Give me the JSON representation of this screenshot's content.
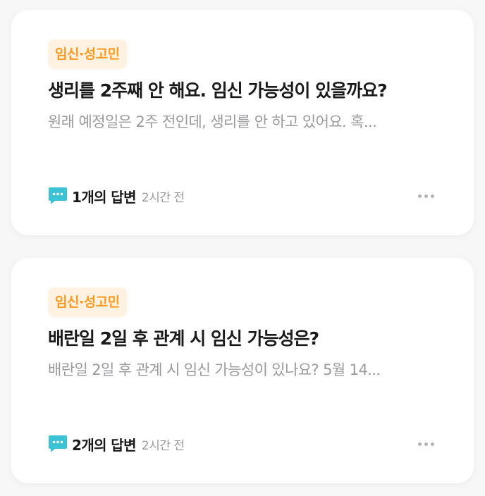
{
  "accent_tag_color": "#ff9a1f",
  "accent_tag_bg": "#fff2e2",
  "comment_icon_color": "#3cc2d6",
  "posts": [
    {
      "tag": "임신·성고민",
      "title": "생리를 2주째 안 해요. 임신 가능성이 있을까요?",
      "preview": "원래 예정일은 2주 전인데, 생리를 안 하고 있어요. 혹...",
      "answers": "1개의 답변",
      "time": "2시간 전",
      "icons": {
        "comment": "comment-icon",
        "more": "more-icon"
      }
    },
    {
      "tag": "임신·성고민",
      "title": "배란일 2일 후 관계 시 임신 가능성은?",
      "preview": "배란일 2일 후 관계 시 임신 가능성이 있나요? 5월 14...",
      "answers": "2개의 답변",
      "time": "2시간 전",
      "icons": {
        "comment": "comment-icon",
        "more": "more-icon"
      }
    }
  ]
}
